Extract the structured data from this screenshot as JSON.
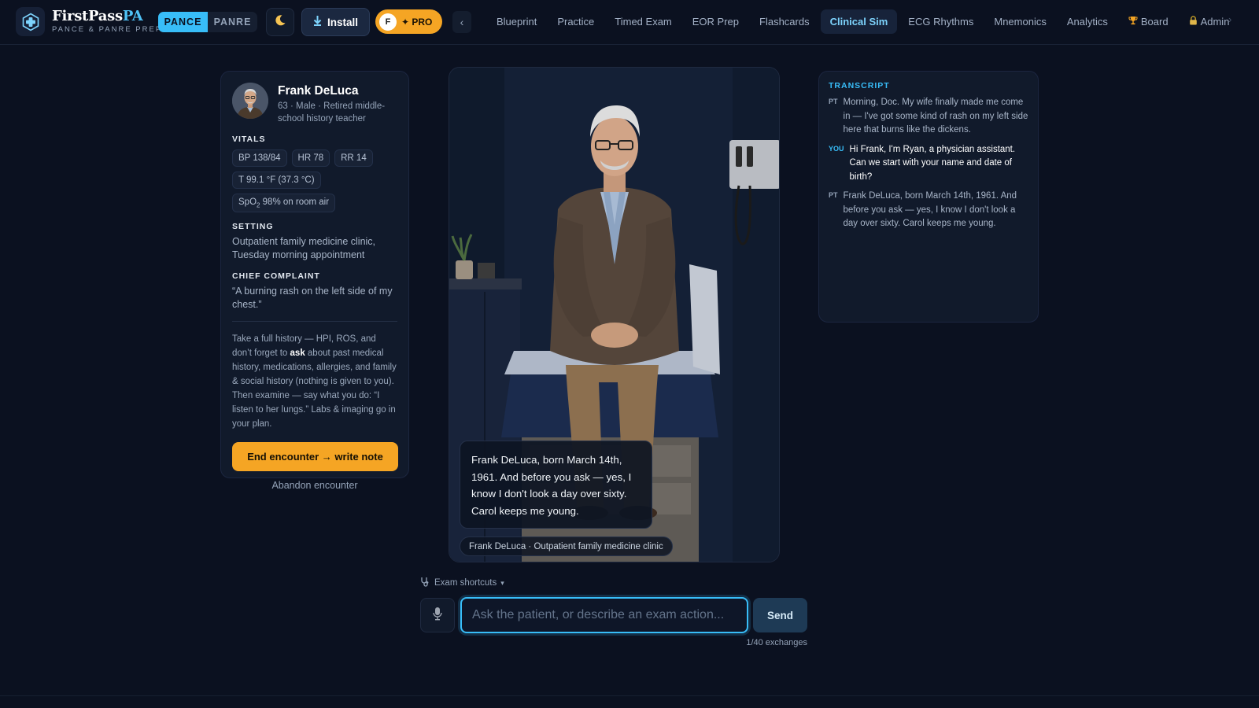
{
  "header": {
    "brand": "FirstPass",
    "brand_accent": "PA",
    "brand_sub": "PANCE & PANRE PREP",
    "exam_toggle": [
      "PANCE",
      "PANRE"
    ],
    "exam_selected": "PANCE",
    "install_label": "Install",
    "pro_avatar": "F",
    "pro_label": "✦ PRO",
    "nav": [
      {
        "label": "Blueprint"
      },
      {
        "label": "Practice"
      },
      {
        "label": "Timed Exam"
      },
      {
        "label": "EOR Prep"
      },
      {
        "label": "Flashcards"
      },
      {
        "label": "Clinical Sim",
        "active": true
      },
      {
        "label": "ECG Rhythms"
      },
      {
        "label": "Mnemonics"
      },
      {
        "label": "Analytics"
      },
      {
        "label": "Board",
        "icon": "trophy-icon"
      },
      {
        "label": "Admin",
        "icon": "lock-icon"
      }
    ]
  },
  "patient": {
    "name": "Frank DeLuca",
    "subtitle": "63 · Male · Retired middle-school history teacher",
    "vitals_title": "VITALS",
    "vitals": [
      "BP 138/84",
      "HR 78",
      "RR 14",
      "T 99.1 °F (37.3 °C)"
    ],
    "spo2_prefix": "SpO",
    "spo2_sub": "2",
    "spo2_rest": " 98% on room air",
    "setting_title": "SETTING",
    "setting": "Outpatient family medicine clinic, Tuesday morning appointment",
    "complaint_title": "CHIEF COMPLAINT",
    "complaint": "“A burning rash on the left side of my chest.”",
    "instr_1": "Take a full history — HPI, ROS, and don’t forget to ",
    "instr_bold": "ask",
    "instr_2": " about past medical history, medications, allergies, and family & social history (nothing is given to you). Then examine — say what you do: “I listen to her lungs.” Labs & imaging go in your plan.",
    "end_button": "End encounter → write note",
    "abandon": "Abandon encounter"
  },
  "scene": {
    "speech": "Frank DeLuca, born March 14th, 1961. And before you ask — yes, I know I don't look a day over sixty. Carol keeps me young.",
    "caption": "Frank DeLuca · Outpatient family medicine clinic"
  },
  "transcript": {
    "title": "TRANSCRIPT",
    "entries": [
      {
        "role": "PT",
        "text": "Morning, Doc. My wife finally made me come in — I've got some kind of rash on my left side here that burns like the dickens."
      },
      {
        "role": "YOU",
        "text": "Hi Frank, I'm Ryan, a physician assistant. Can we start with your name and date of birth?"
      },
      {
        "role": "PT",
        "text": "Frank DeLuca, born March 14th, 1961. And before you ask — yes, I know I don't look a day over sixty. Carol keeps me young."
      }
    ]
  },
  "input": {
    "shortcuts_label": "Exam shortcuts",
    "placeholder": "Ask the patient, or describe an exam action...",
    "value": "",
    "send": "Send",
    "exchanges": "1/40 exchanges"
  },
  "colors": {
    "background": "#0b1120",
    "card": "#111a2b",
    "accent": "#38bdf8",
    "cta": "#f5a524"
  }
}
